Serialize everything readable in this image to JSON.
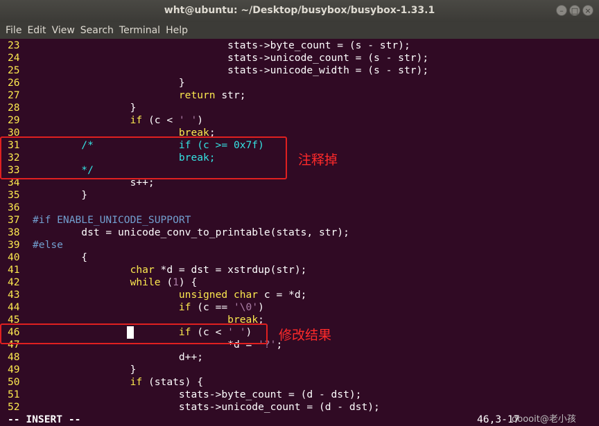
{
  "window": {
    "title": "wht@ubuntu: ~/Desktop/busybox/busybox-1.33.1"
  },
  "menu": [
    "File",
    "Edit",
    "View",
    "Search",
    "Terminal",
    "Help"
  ],
  "lines": [
    {
      "n": "23",
      "t": "                                stats->byte_count = (s - str);"
    },
    {
      "n": "24",
      "t": "                                stats->unicode_count = (s - str);"
    },
    {
      "n": "25",
      "t": "                                stats->unicode_width = (s - str);"
    },
    {
      "n": "26",
      "t": "                        }"
    },
    {
      "n": "27",
      "pre": "                        ",
      "kw": "return",
      "t": " str;"
    },
    {
      "n": "28",
      "t": "                }"
    },
    {
      "n": "29",
      "pre": "                ",
      "kw": "if",
      "t": " (c < ",
      "str": "' '",
      "post": ")"
    },
    {
      "n": "30",
      "pre": "                        ",
      "kw": "break",
      "t": ";"
    },
    {
      "n": "31",
      "cm": "        /*              if (c >= 0x7f)"
    },
    {
      "n": "32",
      "cm": "                        break;"
    },
    {
      "n": "33",
      "cm": "        */"
    },
    {
      "n": "34",
      "t": "                s++;"
    },
    {
      "n": "35",
      "t": "        }"
    },
    {
      "n": "36",
      "t": ""
    },
    {
      "n": "37",
      "pp": "#if ENABLE_UNICODE_SUPPORT"
    },
    {
      "n": "38",
      "t": "        dst = unicode_conv_to_printable(stats, str);"
    },
    {
      "n": "39",
      "pp": "#else"
    },
    {
      "n": "40",
      "t": "        {"
    },
    {
      "n": "41",
      "pre": "                ",
      "kw": "char",
      "t": " *d = dst = xstrdup(str);"
    },
    {
      "n": "42",
      "pre": "                ",
      "kw": "while",
      "t": " (",
      "num": "1",
      "post": ") {"
    },
    {
      "n": "43",
      "pre": "                        ",
      "kw": "unsigned char",
      "t": " c = *d;"
    },
    {
      "n": "44",
      "pre": "                        ",
      "kw": "if",
      "t": " (c == ",
      "str": "'\\0'",
      "post": ")"
    },
    {
      "n": "45",
      "pre": "                                ",
      "kw": "break",
      "t": ";"
    },
    {
      "n": "46",
      "pre": "                        ",
      "kw": "if",
      "t": " (c < ",
      "str": "' '",
      "post": ")"
    },
    {
      "n": "47",
      "t": "                                *d = ",
      "str": "'?'",
      "post": ";"
    },
    {
      "n": "48",
      "t": "                        d++;"
    },
    {
      "n": "49",
      "t": "                }"
    },
    {
      "n": "50",
      "pre": "                ",
      "kw": "if",
      "t": " (stats) {"
    },
    {
      "n": "51",
      "t": "                        stats->byte_count = (d - dst);"
    },
    {
      "n": "52",
      "t": "                        stats->unicode_count = (d - dst);"
    }
  ],
  "status": {
    "mode": "-- INSERT --",
    "position": "46,3-17",
    "watermark": "doooit@老小孩"
  },
  "annotations": {
    "comment_out": "注释掉",
    "modified": "修改结果"
  },
  "colors": {
    "background": "#300a24",
    "highlight_box": "#e02020"
  }
}
